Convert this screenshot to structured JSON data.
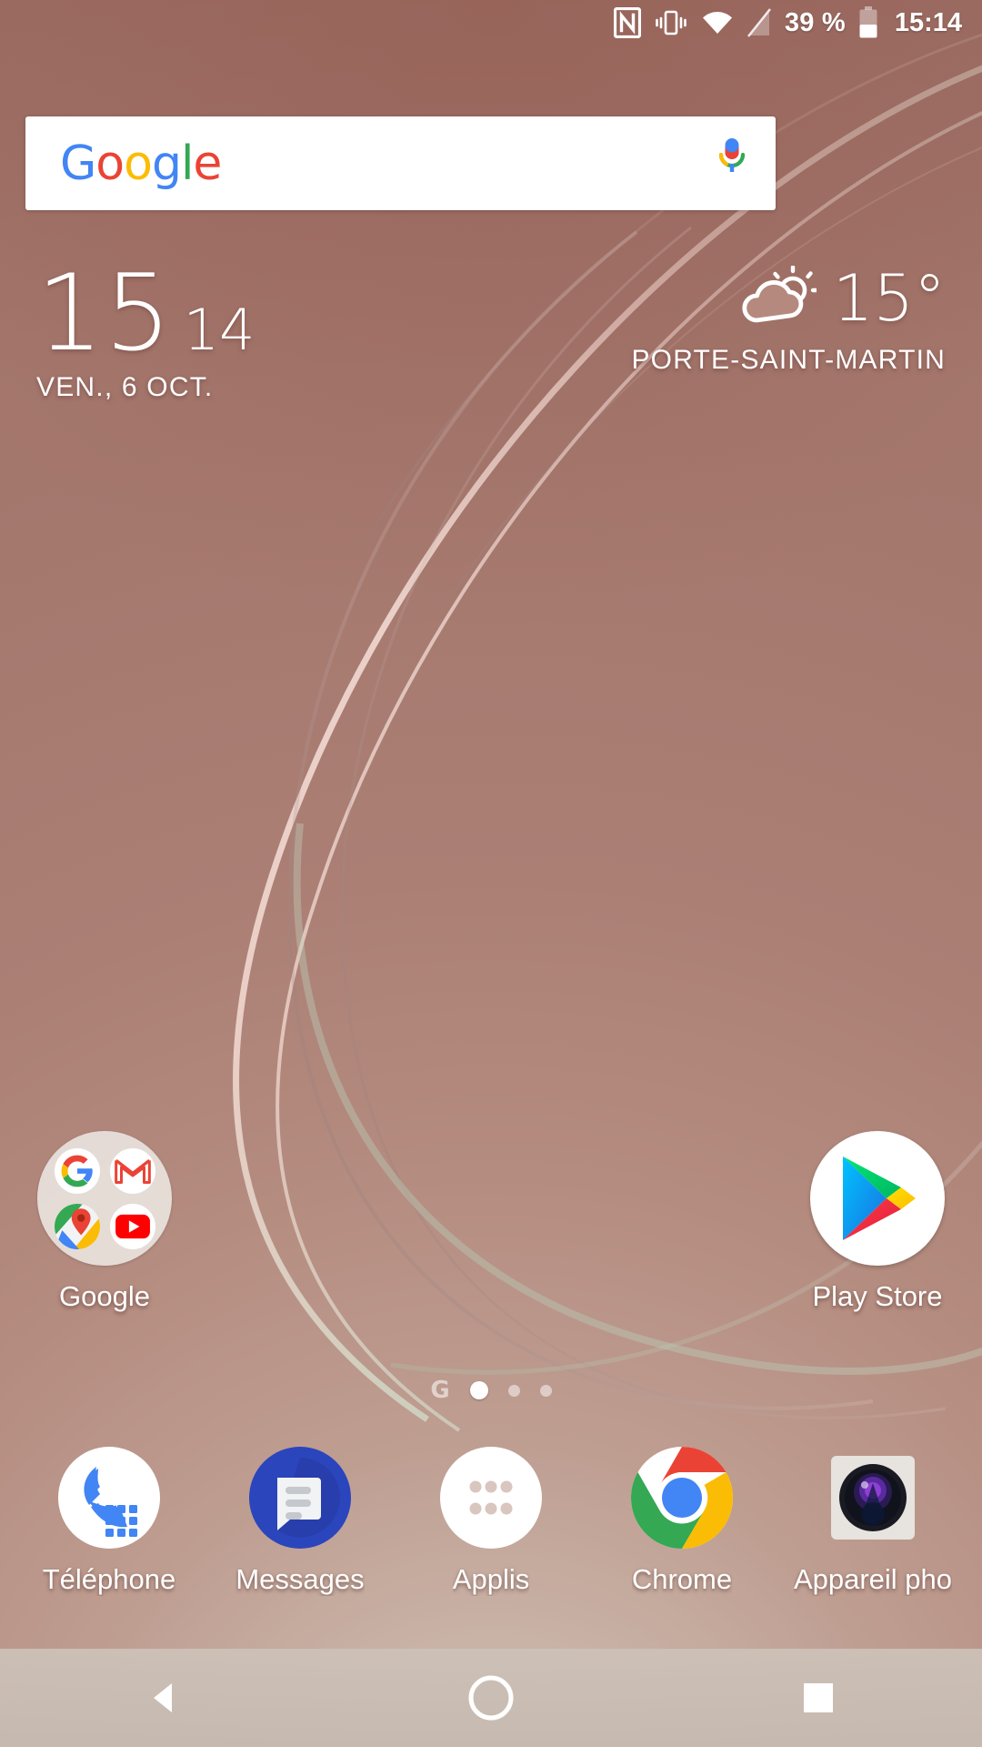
{
  "statusbar": {
    "icons": [
      "nfc-icon",
      "vibrate-icon",
      "wifi-icon",
      "sim-off-icon",
      "battery-icon"
    ],
    "battery_percent": "39 %",
    "clock": "15:14"
  },
  "search_widget": {
    "logo_letters": [
      "G",
      "o",
      "o",
      "g",
      "l",
      "e"
    ],
    "mic_icon": "microphone-icon",
    "colors": {
      "blue": "#4285F4",
      "red": "#EA4335",
      "yellow": "#FBBC05",
      "green": "#34A853"
    }
  },
  "clock_widget": {
    "hours": "15",
    "minutes": "14",
    "date": "VEN., 6 OCT."
  },
  "weather_widget": {
    "icon": "partly-cloudy-icon",
    "temperature": "15°",
    "location": "PORTE-SAINT-MARTIN"
  },
  "home_icons": [
    {
      "name": "Google",
      "type": "folder",
      "contents": [
        "google-icon",
        "gmail-icon",
        "maps-icon",
        "youtube-icon"
      ]
    },
    {
      "name": "Play Store",
      "type": "app",
      "icon": "play-store-icon"
    }
  ],
  "page_indicator": {
    "google_glyph": "G",
    "pages": 3,
    "active_page": 1
  },
  "dock": [
    {
      "label": "Téléphone",
      "icon": "phone-icon"
    },
    {
      "label": "Messages",
      "icon": "messages-icon"
    },
    {
      "label": "Applis",
      "icon": "app-drawer-icon"
    },
    {
      "label": "Chrome",
      "icon": "chrome-icon"
    },
    {
      "label": "Appareil pho",
      "icon": "camera-icon"
    }
  ],
  "navbar": {
    "back": "back-icon",
    "home": "home-icon",
    "recents": "recents-icon"
  }
}
